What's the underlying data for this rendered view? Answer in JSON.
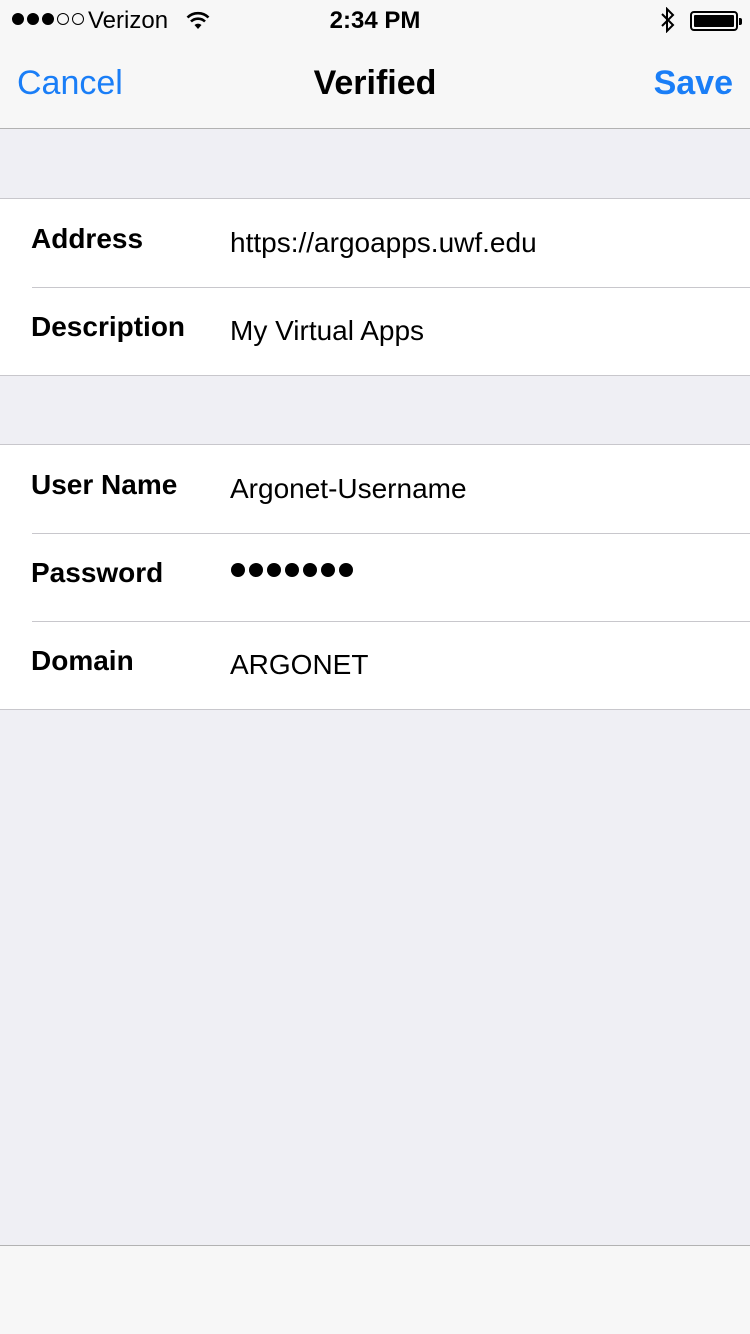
{
  "status_bar": {
    "signal_bars_filled": 3,
    "signal_bars_total": 5,
    "carrier": "Verizon",
    "time": "2:34 PM",
    "battery_level": 1.0,
    "icons": [
      "wifi-icon",
      "bluetooth-icon",
      "battery-icon"
    ]
  },
  "nav": {
    "cancel_label": "Cancel",
    "title": "Verified",
    "save_label": "Save"
  },
  "sections": [
    {
      "rows": [
        {
          "label": "Address",
          "value": "https://argoapps.uwf.edu"
        },
        {
          "label": "Description",
          "value": "My Virtual Apps"
        }
      ]
    },
    {
      "rows": [
        {
          "label": "User Name",
          "value": "Argonet-Username"
        },
        {
          "label": "Password",
          "masked_length": 7
        },
        {
          "label": "Domain",
          "value": "ARGONET"
        }
      ]
    }
  ],
  "colors": {
    "accent": "#1a7ef7",
    "background": "#efeff4",
    "bar_background": "#f7f7f7"
  }
}
